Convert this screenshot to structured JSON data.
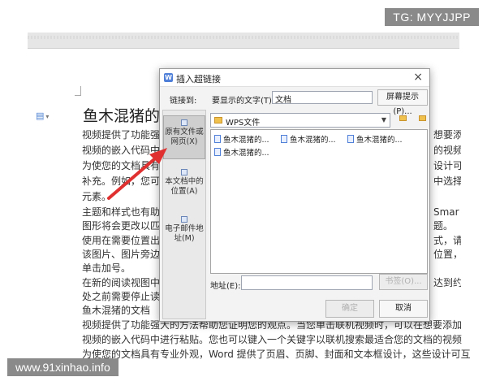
{
  "watermark_top": "TG: MYYJJPP",
  "watermark_bottom": "www.91xinhao.info",
  "document": {
    "title": "鱼木混猪的",
    "lines": [
      "视频提供了功能强",
      "视频的嵌入代码中",
      "为使您的文档具有",
      "补充。例如，您可",
      "元素。",
      "主题和样式也有助",
      "图形将会更改以匹",
      "使用在需要位置出",
      "该图片、图片旁边",
      "单击加号。",
      "在新的阅读视图中",
      "处之前需要停止读",
      "鱼木混猪的文档",
      "视频提供了功能强大的方法帮助您证明您的观点。当您单击联机视频时，可以在想要添加",
      "视频的嵌入代码中进行粘贴。您也可以键入一个关键字以联机搜索最适合您的文档的视频",
      "为使您的文档具有专业外观，Word 提供了页眉、页脚、封面和文本框设计，这些设计可互"
    ],
    "right_fragments": [
      "想要添",
      "的视频",
      "设计可",
      "中选择",
      "",
      "Smar",
      "题。",
      "式，请",
      "位置，",
      "",
      "达到约"
    ]
  },
  "dialog": {
    "title": "插入超链接",
    "link_to_label": "链接到:",
    "display_text_label": "要显示的文字(T):",
    "display_text_value": "文档",
    "screen_tip_button": "屏幕提示(P)...",
    "sidebar": [
      {
        "label": "原有文件或网页(X)"
      },
      {
        "label": "本文档中的位置(A)"
      },
      {
        "label": "电子邮件地址(M)"
      }
    ],
    "folder": "WPS文件",
    "files": [
      "鱼木混猪的...",
      "鱼木混猪的...",
      "鱼木混猪的...",
      "鱼木混猪的..."
    ],
    "address_label": "地址(E):",
    "address_value": "",
    "bookmark_button": "书签(O)...",
    "ok_button": "确定",
    "cancel_button": "取消",
    "close_glyph": "×",
    "app_icon_glyph": "W"
  },
  "colors": {
    "annotation_arrow": "#e03030",
    "accent": "#4f7fd8"
  }
}
